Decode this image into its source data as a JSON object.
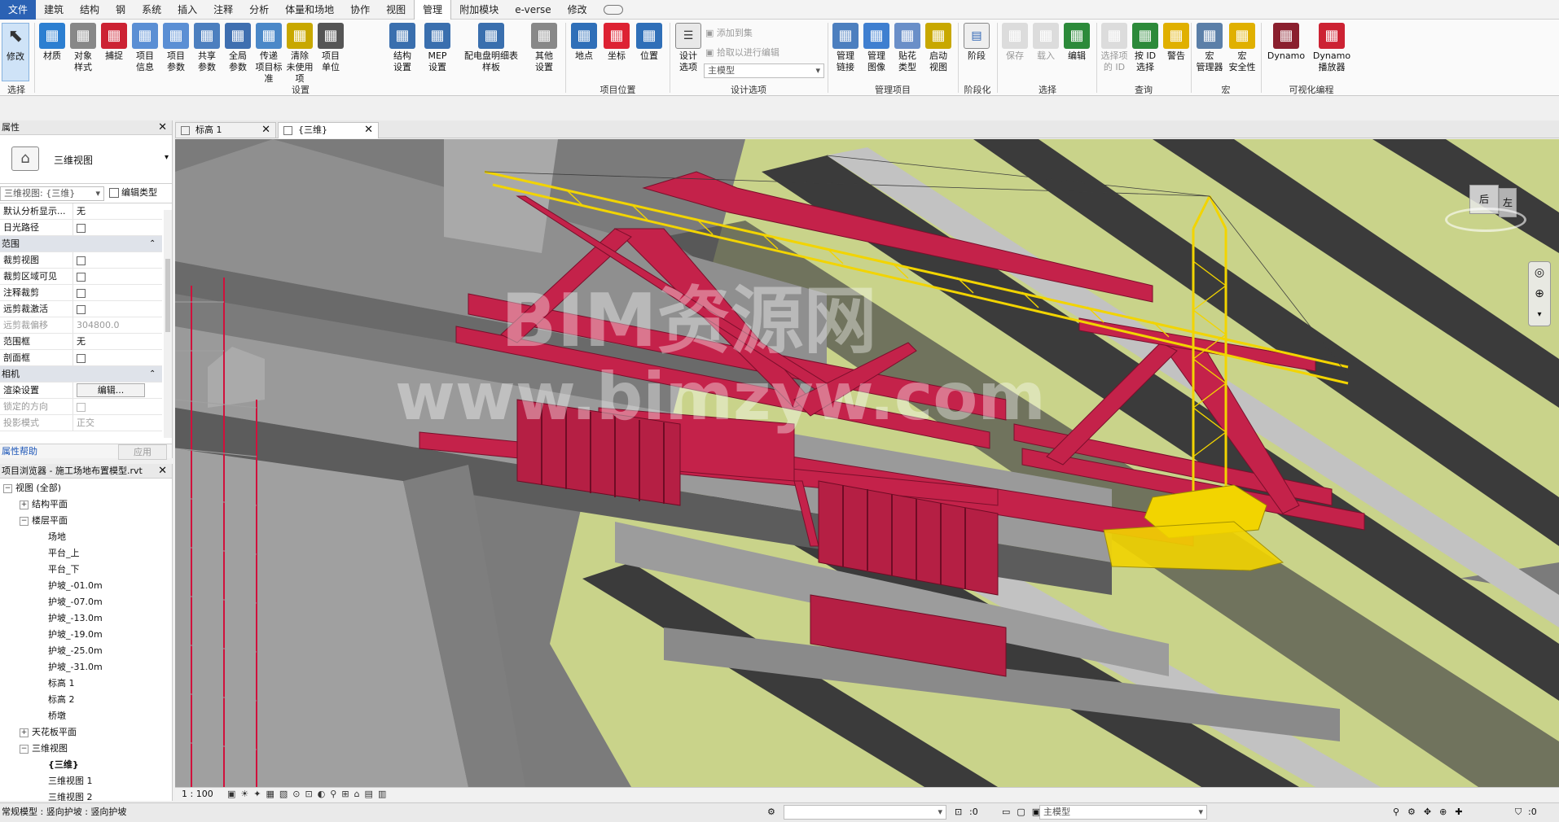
{
  "menu": {
    "tabs": [
      "文件",
      "建筑",
      "结构",
      "钢",
      "系统",
      "插入",
      "注释",
      "分析",
      "体量和场地",
      "协作",
      "视图",
      "管理",
      "附加模块",
      "e-verse",
      "修改"
    ],
    "active_index": 11
  },
  "ribbon": {
    "select": {
      "modify": "修改",
      "group": "选择"
    },
    "settings_buttons": [
      {
        "label1": "材质",
        "label2": ""
      },
      {
        "label1": "对象",
        "label2": "样式"
      },
      {
        "label1": "捕捉",
        "label2": ""
      },
      {
        "label1": "项目",
        "label2": "信息"
      },
      {
        "label1": "项目",
        "label2": "参数"
      },
      {
        "label1": "共享",
        "label2": "参数"
      },
      {
        "label1": "全局",
        "label2": "参数"
      },
      {
        "label1": "传递",
        "label2": "项目标准"
      },
      {
        "label1": "清除",
        "label2": "未使用项"
      },
      {
        "label1": "项目",
        "label2": "单位"
      },
      {
        "label1": "结构",
        "label2": "设置"
      },
      {
        "label1": "MEP",
        "label2": "设置"
      },
      {
        "label1": "配电盘明细表",
        "label2": "样板"
      },
      {
        "label1": "其他",
        "label2": "设置"
      }
    ],
    "settings_group": "设置",
    "location_buttons": [
      {
        "label1": "地点",
        "label2": ""
      },
      {
        "label1": "坐标",
        "label2": ""
      },
      {
        "label1": "位置",
        "label2": ""
      }
    ],
    "location_group": "项目位置",
    "design_options": {
      "label1": "设计",
      "label2": "选项",
      "add_to_set": "添加到集",
      "pick_to_edit": "拾取以进行编辑",
      "combo": "主模型",
      "group": "设计选项"
    },
    "manage_project": {
      "buttons": [
        {
          "label1": "管理",
          "label2": "链接"
        },
        {
          "label1": "管理",
          "label2": "图像"
        },
        {
          "label1": "贴花",
          "label2": "类型"
        },
        {
          "label1": "启动",
          "label2": "视图"
        }
      ],
      "group": "管理项目"
    },
    "phasing": {
      "label1": "阶段",
      "group": "阶段化"
    },
    "selection": {
      "buttons": [
        {
          "label1": "保存",
          "label2": ""
        },
        {
          "label1": "载入",
          "label2": ""
        },
        {
          "label1": "编辑",
          "label2": ""
        }
      ],
      "group": "选择"
    },
    "inquiry": {
      "buttons": [
        {
          "label1": "选择项",
          "label2": "的 ID"
        },
        {
          "label1": "按 ID",
          "label2": "选择"
        },
        {
          "label1": "警告",
          "label2": ""
        }
      ],
      "group": "查询"
    },
    "macros": {
      "buttons": [
        {
          "label1": "宏",
          "label2": "管理器"
        },
        {
          "label1": "宏",
          "label2": "安全性"
        }
      ],
      "group": "宏"
    },
    "visual_programming": {
      "buttons": [
        {
          "label1": "Dynamo",
          "label2": ""
        },
        {
          "label1": "Dynamo",
          "label2": "播放器"
        }
      ],
      "group": "可视化编程"
    }
  },
  "properties": {
    "title": "属性",
    "type_name": "三维视图",
    "selector": "三维视图: {三维}",
    "edit_type": "编辑类型",
    "rows": [
      {
        "k": "默认分析显示...",
        "v": "无",
        "type": "text"
      },
      {
        "k": "日光路径",
        "v": "",
        "type": "check"
      },
      {
        "k": "范围",
        "v": "",
        "type": "group"
      },
      {
        "k": "裁剪视图",
        "v": "",
        "type": "check"
      },
      {
        "k": "裁剪区域可见",
        "v": "",
        "type": "check"
      },
      {
        "k": "注释裁剪",
        "v": "",
        "type": "check"
      },
      {
        "k": "远剪裁激活",
        "v": "",
        "type": "check"
      },
      {
        "k": "远剪裁偏移",
        "v": "304800.0",
        "type": "dim"
      },
      {
        "k": "范围框",
        "v": "无",
        "type": "text"
      },
      {
        "k": "剖面框",
        "v": "",
        "type": "check"
      },
      {
        "k": "相机",
        "v": "",
        "type": "group"
      },
      {
        "k": "渲染设置",
        "v": "编辑...",
        "type": "button"
      },
      {
        "k": "锁定的方向",
        "v": "",
        "type": "dimcheck"
      },
      {
        "k": "投影模式",
        "v": "正交",
        "type": "dim"
      }
    ],
    "help": "属性帮助",
    "apply": "应用"
  },
  "browser": {
    "title": "项目浏览器 - 施工场地布置模型.rvt",
    "nodes": [
      {
        "text": "视图 (全部)",
        "level": 0,
        "tog": "−"
      },
      {
        "text": "结构平面",
        "level": 1,
        "tog": "+"
      },
      {
        "text": "楼层平面",
        "level": 1,
        "tog": "−"
      },
      {
        "text": "场地",
        "level": 2,
        "tog": ""
      },
      {
        "text": "平台_上",
        "level": 2,
        "tog": ""
      },
      {
        "text": "平台_下",
        "level": 2,
        "tog": ""
      },
      {
        "text": "护坡_-01.0m",
        "level": 2,
        "tog": ""
      },
      {
        "text": "护坡_-07.0m",
        "level": 2,
        "tog": ""
      },
      {
        "text": "护坡_-13.0m",
        "level": 2,
        "tog": ""
      },
      {
        "text": "护坡_-19.0m",
        "level": 2,
        "tog": ""
      },
      {
        "text": "护坡_-25.0m",
        "level": 2,
        "tog": ""
      },
      {
        "text": "护坡_-31.0m",
        "level": 2,
        "tog": ""
      },
      {
        "text": "标高 1",
        "level": 2,
        "tog": ""
      },
      {
        "text": "标高 2",
        "level": 2,
        "tog": ""
      },
      {
        "text": "桥墩",
        "level": 2,
        "tog": ""
      },
      {
        "text": "天花板平面",
        "level": 1,
        "tog": "+"
      },
      {
        "text": "三维视图",
        "level": 1,
        "tog": "−"
      },
      {
        "text": "{三维}",
        "level": 2,
        "tog": "",
        "bold": true
      },
      {
        "text": "三维视图 1",
        "level": 2,
        "tog": ""
      },
      {
        "text": "三维视图 2",
        "level": 2,
        "tog": ""
      }
    ]
  },
  "view_tabs": [
    {
      "label": "标高 1",
      "active": false
    },
    {
      "label": "{三维}",
      "active": true
    }
  ],
  "viewport": {
    "watermark1": "BIM资源网",
    "watermark2": "www.bimzyw.com",
    "viewcube_labels": [
      "后",
      "左"
    ]
  },
  "viewbar": {
    "scale": "1 : 100"
  },
  "status": {
    "text": "常规模型 : 竖向护坡 : 竖向护坡",
    "selection_count": ":0",
    "model": "主模型",
    "filter_count": ":0"
  },
  "colors": {
    "accent": "#2b62b4",
    "crane_yellow": "#f2d400",
    "steel_red": "#c4224a",
    "ground_green": "#c9d38a",
    "concrete": "#8c8c8c"
  }
}
